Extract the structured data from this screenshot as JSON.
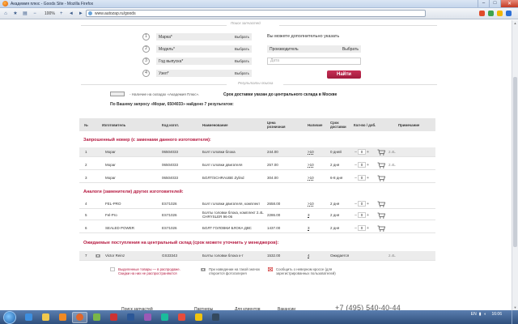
{
  "window": {
    "title": "Академия плюс - Goods Site - Mozilla Firefox",
    "zoom": "100%",
    "url": "www.autozap.ru/goods"
  },
  "search": {
    "section_label": "Поиск запчастей",
    "fields": [
      {
        "num": "1",
        "label": "Марка*",
        "action": "Выбрать"
      },
      {
        "num": "2",
        "label": "Модель*",
        "action": "Выбрать"
      },
      {
        "num": "3",
        "label": "Год выпуска*",
        "action": "Выбрать"
      },
      {
        "num": "4",
        "label": "Узел*",
        "action": "Выбрать"
      }
    ],
    "extra_label": "Вы можете дополнительно указать",
    "manufacturer_label": "Производитель",
    "manufacturer_action": "Выбрать",
    "date_placeholder": "Дата",
    "find_button": "Найти"
  },
  "results": {
    "section_label": "Результаты поиска",
    "legend_text": "- Наличие на складах «Академия Плюс».",
    "legend_bold": "Срок доставки указан до центрального склада в Москве",
    "query_text": "По Вашему запросу «Mopar, 6504033» найдено 7 результатов:"
  },
  "table": {
    "headers": {
      "num": "№",
      "maker": "Изготовитель",
      "code": "Код изгот.",
      "name": "Наименование",
      "price": "Цена розничная",
      "avail": "Наличие",
      "term": "Срок доставки",
      "qty": "Кол-во / доб.",
      "note": "Примечание"
    },
    "groups": {
      "requested": "Запрошенный номер (с заменами данного изготовителя):",
      "analogs": "Аналоги (заменители) других изготовителей:",
      "expected": "Ожидаемые поступления на центральный склад (срок можете уточнить у менеджеров):"
    },
    "rows": [
      {
        "num": "1",
        "maker": "Mopar",
        "code": "06504033",
        "name": "Болт головки блока",
        "price": "244.00",
        "avail": ">10",
        "term": "0 дней",
        "qty": "0",
        "note": "2.4L"
      },
      {
        "num": "2",
        "maker": "Mopar",
        "code": "06504033",
        "name": "Болт головки двигателя",
        "price": "257.00",
        "avail": ">10",
        "term": "2 дня",
        "qty": "0",
        "note": "2.4L"
      },
      {
        "num": "3",
        "maker": "Mopar",
        "code": "06504033",
        "name": "БОЛТ/SCHRAUBE Zylind",
        "price": "304.00",
        "avail": ">10",
        "term": "6-8 дня",
        "qty": "0",
        "note": ""
      },
      {
        "num": "4",
        "maker": "FEL-PRO",
        "code": "ES71026",
        "name": "Болт головки двигателя, комплект",
        "price": "2658.00",
        "avail": ">10",
        "term": "2 дня",
        "qty": "0",
        "note": ""
      },
      {
        "num": "5",
        "maker": "Fel-Pro",
        "code": "ES71026",
        "name": "Болты головки блока, комплект 2.4L CHRYSLER 96-06",
        "price": "2286.00",
        "avail": "3",
        "term": "2 дня",
        "qty": "0",
        "note": ""
      },
      {
        "num": "6",
        "maker": "SEALED POWER",
        "code": "ES71026",
        "name": "БОЛТ ГОЛОВКИ БЛОКА ДВС",
        "price": "1437.00",
        "avail": "3",
        "term": "2 дня",
        "qty": "0",
        "note": ""
      },
      {
        "num": "7",
        "maker": "Victor Reinz",
        "code": "GS33343",
        "name": "Болты головки блока к-т",
        "price": "1532.00",
        "avail": "4",
        "term": "Ожидается",
        "qty": "",
        "note": "2.4L"
      }
    ]
  },
  "footnotes": {
    "highlighted": "Выделенные товары — в распродаже. Скидки на них не распространяются",
    "camera": "При наведении на такой значок откроется фотогалерея",
    "report": "Сообщить о неверном кроссе (для зарегистрированных пользователей)"
  },
  "footer": {
    "links": [
      "Поиск запчастей",
      "Партнеры",
      "Для клиентов",
      "Вакансии"
    ],
    "phone": "+7 (495) 540-40-44"
  },
  "taskbar": {
    "lang": "EN",
    "clock": "16:06"
  },
  "colors": {
    "accent": "#b5183f",
    "button": "#b0213f",
    "row_shade": "#ececec"
  }
}
